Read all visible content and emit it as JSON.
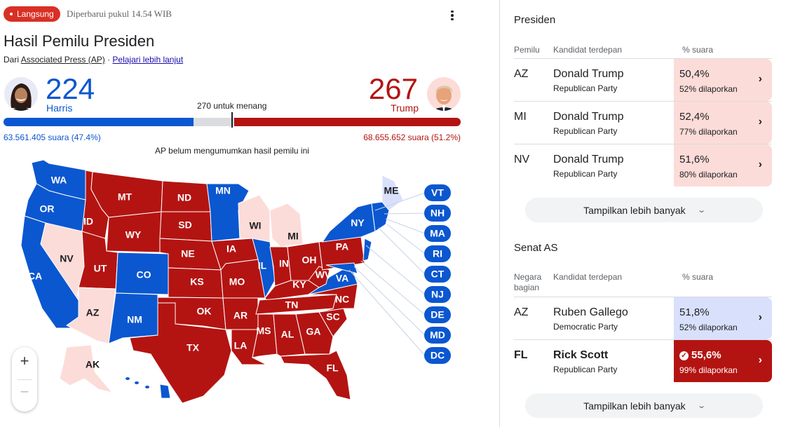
{
  "header": {
    "live_label": "Langsung",
    "updated": "Diperbarui pukul 14.54 WIB",
    "menu_icon": "more-vert-icon"
  },
  "title": "Hasil Pemilu Presiden",
  "source": {
    "prefix": "Dari",
    "provider": "Associated Press (AP)",
    "separator": "·",
    "learn_more": "Pelajari lebih lanjut"
  },
  "race": {
    "harris": {
      "name": "Harris",
      "electoral_votes": "224",
      "popular_votes": "63.561.405 suara (47.4%)",
      "bar_fraction": 0.416
    },
    "trump": {
      "name": "Trump",
      "electoral_votes": "267",
      "popular_votes": "68.655.652 suara (51.2%)",
      "bar_fraction": 0.496
    },
    "to_win": "270 untuk menang",
    "ap_note": "AP belum mengumumkan hasil pemilu ini"
  },
  "colors": {
    "dem": "#0b57d0",
    "rep": "#b31412",
    "dem_leaning": "#d9e0fc",
    "rep_leaning": "#fcdcd8",
    "live": "#d93025"
  },
  "map": {
    "states": {
      "WA": "dem",
      "OR": "dem",
      "CA": "dem",
      "NV": "rep_leaning",
      "ID": "rep",
      "MT": "rep",
      "WY": "rep",
      "UT": "rep",
      "AZ": "rep_leaning",
      "CO": "dem",
      "NM": "dem",
      "ND": "rep",
      "SD": "rep",
      "NE": "rep",
      "KS": "rep",
      "OK": "rep",
      "TX": "rep",
      "MN": "dem",
      "IA": "rep",
      "MO": "rep",
      "AR": "rep",
      "LA": "rep",
      "WI": "rep_leaning",
      "IL": "dem",
      "MI": "rep_leaning",
      "IN": "rep",
      "OH": "rep",
      "KY": "rep",
      "TN": "rep",
      "MS": "rep",
      "AL": "rep",
      "GA": "rep",
      "FL": "rep",
      "SC": "rep",
      "NC": "rep",
      "VA": "dem",
      "WV": "rep",
      "PA": "rep",
      "NY": "dem",
      "ME": "dem_leaning",
      "AK": "rep_leaning",
      "HI": "dem",
      "VT": "dem",
      "NH": "dem",
      "MA": "dem",
      "RI": "dem",
      "CT": "dem",
      "NJ": "dem",
      "DE": "dem",
      "MD": "dem",
      "DC": "dem"
    },
    "callouts": [
      "VT",
      "NH",
      "MA",
      "RI",
      "CT",
      "NJ",
      "DE",
      "MD",
      "DC"
    ],
    "zoom_in": "+",
    "zoom_out": "−"
  },
  "president": {
    "title": "Presiden",
    "headers": {
      "col1": "Pemilu",
      "col2": "Kandidat terdepan",
      "col3": "% suara"
    },
    "rows": [
      {
        "state": "AZ",
        "candidate": "Donald Trump",
        "party": "Republican Party",
        "pct": "50,4%",
        "reported": "52% dilaporkan",
        "style": "r-light"
      },
      {
        "state": "MI",
        "candidate": "Donald Trump",
        "party": "Republican Party",
        "pct": "52,4%",
        "reported": "77% dilaporkan",
        "style": "r-light"
      },
      {
        "state": "NV",
        "candidate": "Donald Trump",
        "party": "Republican Party",
        "pct": "51,6%",
        "reported": "80% dilaporkan",
        "style": "r-light"
      }
    ],
    "more_label": "Tampilkan lebih banyak"
  },
  "senate": {
    "title": "Senat AS",
    "headers": {
      "col1": "Negara bagian",
      "col2": "Kandidat terdepan",
      "col3": "% suara"
    },
    "rows": [
      {
        "state": "AZ",
        "candidate": "Ruben Gallego",
        "party": "Democratic Party",
        "pct": "51,8%",
        "reported": "52% dilaporkan",
        "style": "d-light",
        "winner": false
      },
      {
        "state": "FL",
        "candidate": "Rick Scott",
        "party": "Republican Party",
        "pct": "55,6%",
        "reported": "99% dilaporkan",
        "style": "r-win",
        "winner": true
      }
    ],
    "more_label": "Tampilkan lebih banyak"
  }
}
